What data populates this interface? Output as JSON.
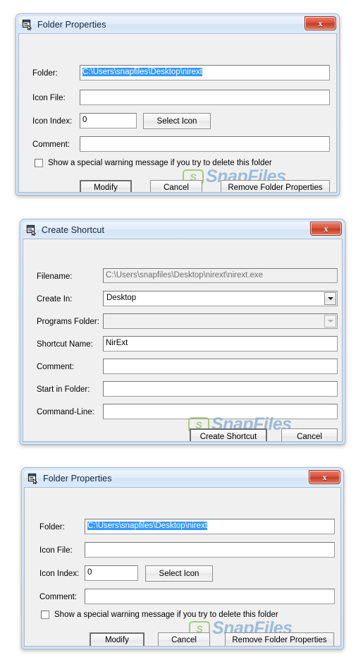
{
  "windows": [
    {
      "id": "folder-properties-1",
      "title": "Folder Properties",
      "icon": "window-properties-icon",
      "close_label": "x",
      "fields": [
        {
          "label": "Folder:",
          "value": "C:\\Users\\snapfiles\\Desktop\\nirext",
          "selected": true
        },
        {
          "label": "Icon File:",
          "value": ""
        },
        {
          "label": "Icon Index:",
          "value": "0"
        },
        {
          "label": "Comment:",
          "value": ""
        }
      ],
      "select_icon_button": "Select Icon",
      "checkbox": {
        "label": "Show a special warning message if you try to delete this folder",
        "checked": false
      },
      "buttons": [
        "Modify",
        "Cancel",
        "Remove Folder Properties"
      ]
    },
    {
      "id": "create-shortcut",
      "title": "Create Shortcut",
      "icon": "window-properties-icon",
      "close_label": "x",
      "fields": [
        {
          "label": "Filename:",
          "value": "C:\\Users\\snapfiles\\Desktop\\nirext\\nirext.exe",
          "disabled": true
        },
        {
          "label": "Create In:",
          "value": "Desktop",
          "type": "combo"
        },
        {
          "label": "Programs Folder:",
          "value": "",
          "type": "combo",
          "disabled": true
        },
        {
          "label": "Shortcut Name:",
          "value": "NirExt"
        },
        {
          "label": "Comment:",
          "value": ""
        },
        {
          "label": "Start in Folder:",
          "value": ""
        },
        {
          "label": "Command-Line:",
          "value": ""
        }
      ],
      "buttons": [
        "Create Shortcut",
        "Cancel"
      ]
    },
    {
      "id": "folder-properties-2",
      "title": "Folder Properties",
      "icon": "window-properties-icon",
      "close_label": "x",
      "fields": [
        {
          "label": "Folder:",
          "value": "C:\\Users\\snapfiles\\Desktop\\nirext",
          "selected": true
        },
        {
          "label": "Icon File:",
          "value": ""
        },
        {
          "label": "Icon Index:",
          "value": "0"
        },
        {
          "label": "Comment:",
          "value": ""
        }
      ],
      "select_icon_button": "Select Icon",
      "checkbox": {
        "label": "Show a special warning message if you try to delete this folder",
        "checked": false
      },
      "buttons": [
        "Modify",
        "Cancel",
        "Remove Folder Properties"
      ]
    }
  ],
  "watermark": {
    "logo": "S",
    "text": "SnapFiles"
  },
  "colors": {
    "close_button": "#c33a22",
    "selection": "#3399ff",
    "titlebar": "#dcebfa",
    "client": "#f0f0f0",
    "watermark_green": "#8cc152",
    "watermark_blue": "#7ea9cf"
  }
}
